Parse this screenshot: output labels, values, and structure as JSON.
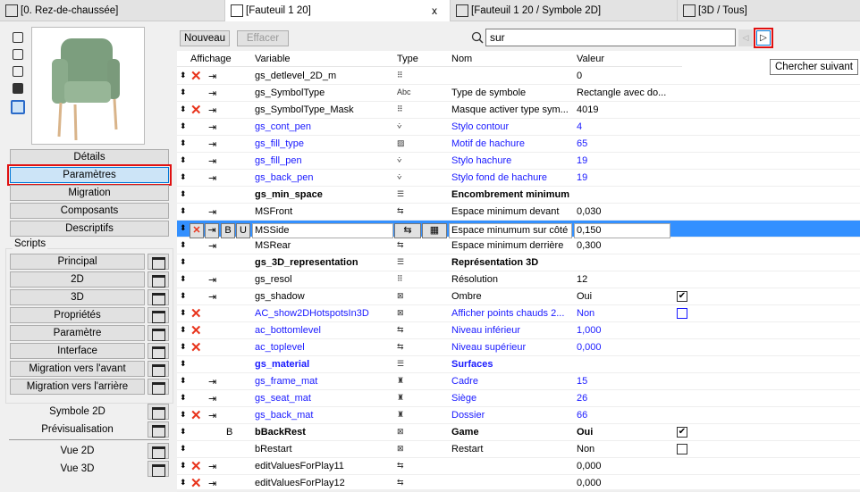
{
  "tabs": [
    {
      "label": "[0. Rez-de-chaussée]"
    },
    {
      "label": "[Fauteuil 1 20]",
      "close": "x"
    },
    {
      "label": "[Fauteuil 1 20 / Symbole 2D]"
    },
    {
      "label": "[3D / Tous]"
    }
  ],
  "left": {
    "buttons": [
      "Détails",
      "Paramètres",
      "Migration",
      "Composants",
      "Descriptifs"
    ],
    "scripts_label": "Scripts",
    "scripts": [
      "Principal",
      "2D",
      "3D",
      "Propriétés",
      "Paramètre",
      "Interface",
      "Migration vers l'avant",
      "Migration vers l'arrière"
    ],
    "extra": [
      "Symbole 2D",
      "Prévisualisation"
    ],
    "views": [
      "Vue 2D",
      "Vue 3D"
    ]
  },
  "toolbar": {
    "new": "Nouveau",
    "delete": "Effacer",
    "search": "sur",
    "tooltip": "Chercher suivant"
  },
  "columns": {
    "display": "Affichage",
    "variable": "Variable",
    "type": "Type",
    "name": "Nom",
    "value": "Valeur"
  },
  "rows": [
    {
      "v": "gs_detlevel_2D_m",
      "t": "int",
      "n": "",
      "val": "0",
      "x": 1,
      "i": 1
    },
    {
      "v": "gs_SymbolType",
      "t": "abc",
      "n": "Type de symbole",
      "val": "Rectangle avec do...",
      "i": 1
    },
    {
      "v": "gs_SymbolType_Mask",
      "t": "int",
      "n": "Masque activer type sym...",
      "val": "4019",
      "x": 1,
      "i": 1
    },
    {
      "v": "gs_cont_pen",
      "t": "pen",
      "n": "Stylo contour",
      "val": "4",
      "i": 1,
      "blue": 1
    },
    {
      "v": "gs_fill_type",
      "t": "fill",
      "n": "Motif de hachure",
      "val": "65",
      "i": 1,
      "blue": 1
    },
    {
      "v": "gs_fill_pen",
      "t": "pen",
      "n": "Stylo hachure",
      "val": "19",
      "i": 1,
      "blue": 1
    },
    {
      "v": "gs_back_pen",
      "t": "pen",
      "n": "Stylo fond de hachure",
      "val": "19",
      "i": 1,
      "blue": 1
    },
    {
      "v": "gs_min_space",
      "t": "title",
      "n": "Encombrement minimum",
      "val": "",
      "bold": 1
    },
    {
      "v": "MSFront",
      "t": "length",
      "n": "Espace minimum devant",
      "val": "0,030",
      "i": 1
    },
    {
      "v": "MSSide",
      "t": "length",
      "n": "Espace minumum sur côté",
      "val": "0,150",
      "sel": 1
    },
    {
      "v": "MSRear",
      "t": "length",
      "n": "Espace minimum derrière",
      "val": "0,300",
      "i": 1
    },
    {
      "v": "gs_3D_representation",
      "t": "title",
      "n": "Représentation 3D",
      "val": "",
      "bold": 1
    },
    {
      "v": "gs_resol",
      "t": "int",
      "n": "Résolution",
      "val": "12",
      "i": 1
    },
    {
      "v": "gs_shadow",
      "t": "bool",
      "n": "Ombre",
      "val": "Oui",
      "i": 1,
      "cb": true
    },
    {
      "v": "AC_show2DHotspotsIn3D",
      "t": "bool",
      "n": "Afficher points chauds 2...",
      "val": "Non",
      "x": 1,
      "blue": 1,
      "cb": false
    },
    {
      "v": "ac_bottomlevel",
      "t": "length",
      "n": "Niveau inférieur",
      "val": "1,000",
      "x": 1,
      "blue": 1
    },
    {
      "v": "ac_toplevel",
      "t": "length",
      "n": "Niveau supérieur",
      "val": "0,000",
      "x": 1,
      "blue": 1
    },
    {
      "v": "gs_material",
      "t": "title",
      "n": "Surfaces",
      "val": "",
      "bold": 1,
      "blue": 1
    },
    {
      "v": "gs_frame_mat",
      "t": "mat",
      "n": "Cadre",
      "val": "15",
      "i": 1,
      "blue": 1
    },
    {
      "v": "gs_seat_mat",
      "t": "mat",
      "n": "Siège",
      "val": "26",
      "i": 1,
      "blue": 1
    },
    {
      "v": "gs_back_mat",
      "t": "mat",
      "n": "Dossier",
      "val": "66",
      "x": 1,
      "i": 1,
      "blue": 1
    },
    {
      "v": "bBackRest",
      "t": "bool",
      "n": "Game",
      "val": "Oui",
      "b": "B",
      "bold": 1,
      "cb": true
    },
    {
      "v": "bRestart",
      "t": "bool",
      "n": "Restart",
      "val": "Non",
      "cb": false
    },
    {
      "v": "editValuesForPlay11",
      "t": "length",
      "n": "",
      "val": "0,000",
      "x": 1,
      "i": 1
    },
    {
      "v": "editValuesForPlay12",
      "t": "length",
      "n": "",
      "val": "0,000",
      "x": 1,
      "i": 1
    }
  ],
  "selected_row": {
    "bold_btn": "B",
    "underline_btn": "U"
  }
}
